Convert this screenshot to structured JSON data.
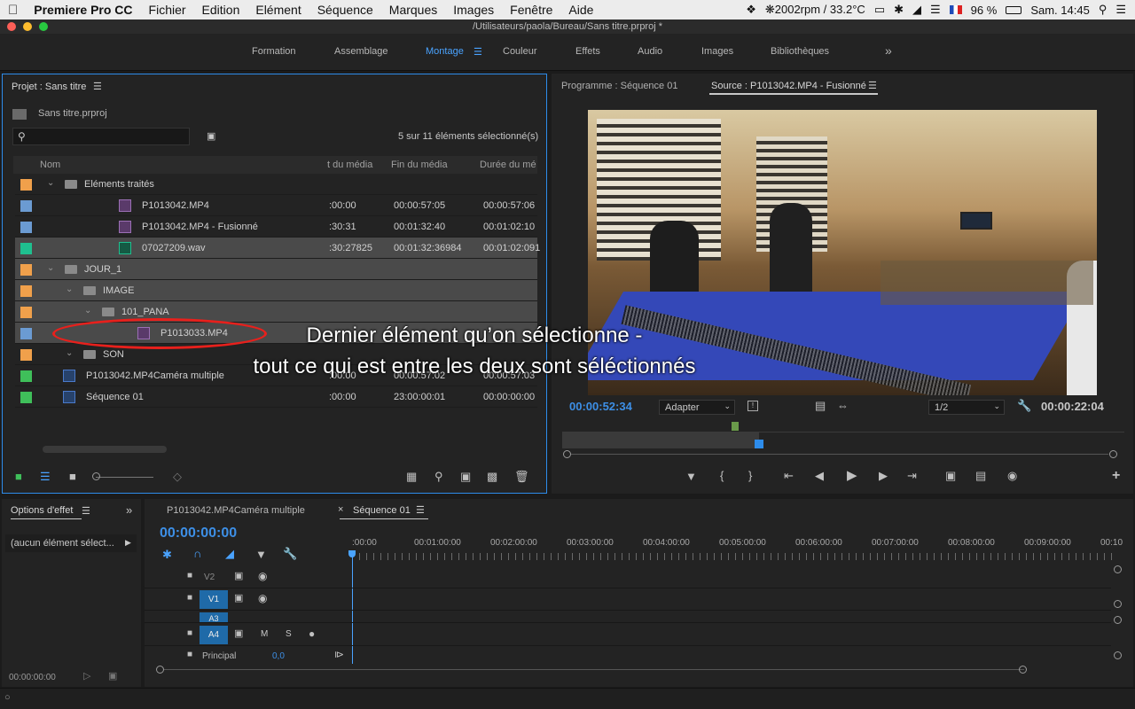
{
  "menubar": {
    "app": "Premiere Pro CC",
    "items": [
      "Fichier",
      "Edition",
      "Elément",
      "Séquence",
      "Marques",
      "Images",
      "Fenêtre",
      "Aide"
    ],
    "cpu": "2002rpm / 33.2°C",
    "battery": "96 %",
    "clock": "Sam. 14:45"
  },
  "window": {
    "title": "/Utilisateurs/paola/Bureau/Sans titre.prproj *"
  },
  "workspaces": [
    "Formation",
    "Assemblage",
    "Montage",
    "Couleur",
    "Effets",
    "Audio",
    "Images",
    "Bibliothèques"
  ],
  "project": {
    "title": "Projet : Sans titre",
    "file": "Sans titre.prproj",
    "search_placeholder": "",
    "selection": "5 sur 11 éléments sélectionné(s)",
    "headers": [
      "Nom",
      "t du média",
      "Fin du média",
      "Durée du mé"
    ],
    "rows": [
      {
        "name": "Eléments traités",
        "c1": "",
        "c2": "",
        "c3": "",
        "color": "#f0a04b",
        "type": "folder",
        "indent": 0,
        "sel": false
      },
      {
        "name": "P1013042.MP4",
        "c1": ":00:00",
        "c2": "00:00:57:05",
        "c3": "00:00:57:06",
        "color": "#6b9bd2",
        "type": "clip",
        "indent": 2,
        "sel": false
      },
      {
        "name": "P1013042.MP4 - Fusionné",
        "c1": ":30:31",
        "c2": "00:01:32:40",
        "c3": "00:01:02:10",
        "color": "#6b9bd2",
        "type": "clip",
        "indent": 2,
        "sel": false
      },
      {
        "name": "07027209.wav",
        "c1": ":30:27825",
        "c2": "00:01:32:36984",
        "c3": "00:01:02:091",
        "color": "#1fbf8f",
        "type": "audio",
        "indent": 2,
        "sel": true
      },
      {
        "name": "JOUR_1",
        "c1": "",
        "c2": "",
        "c3": "",
        "color": "#f0a04b",
        "type": "folder",
        "indent": 0,
        "sel": true
      },
      {
        "name": "IMAGE",
        "c1": "",
        "c2": "",
        "c3": "",
        "color": "#f0a04b",
        "type": "folder",
        "indent": 1,
        "sel": true
      },
      {
        "name": "101_PANA",
        "c1": "",
        "c2": "",
        "c3": "",
        "color": "#f0a04b",
        "type": "folder",
        "indent": 2,
        "sel": true
      },
      {
        "name": "P1013033.MP4",
        "c1": "",
        "c2": "",
        "c3": "",
        "color": "#6b9bd2",
        "type": "clip",
        "indent": 3,
        "sel": true
      },
      {
        "name": "SON",
        "c1": "",
        "c2": "",
        "c3": "",
        "color": "#f0a04b",
        "type": "folder",
        "indent": 1,
        "sel": false
      },
      {
        "name": "P1013042.MP4Caméra multiple",
        "c1": ":00:00",
        "c2": "00:00:57:02",
        "c3": "00:00:57:03",
        "color": "#3fbf5a",
        "type": "seq",
        "indent": 0,
        "sel": false
      },
      {
        "name": "Séquence 01",
        "c1": ":00:00",
        "c2": "23:00:00:01",
        "c3": "00:00:00:00",
        "color": "#3fbf5a",
        "type": "seq",
        "indent": 0,
        "sel": false
      }
    ]
  },
  "monitor": {
    "tab_program": "Programme : Séquence 01",
    "tab_source": "Source : P1013042.MP4 - Fusionné",
    "tc_left": "00:00:52:34",
    "fit": "Adapter",
    "res": "1/2",
    "tc_right": "00:00:22:04"
  },
  "effect": {
    "title": "Options d'effet",
    "none": "(aucun élément sélect...",
    "tc": "00:00:00:00"
  },
  "timeline": {
    "tab1": "P1013042.MP4Caméra multiple",
    "tab2": "Séquence 01",
    "tc": "00:00:00:00",
    "ruler": [
      ":00:00",
      "00:01:00:00",
      "00:02:00:00",
      "00:03:00:00",
      "00:04:00:00",
      "00:05:00:00",
      "00:06:00:00",
      "00:07:00:00",
      "00:08:00:00",
      "00:09:00:00",
      "00:10"
    ],
    "tracks": [
      "V2",
      "V1",
      "A3",
      "A4"
    ],
    "m": "M",
    "s": "S",
    "master": "Principal",
    "master_val": "0,0"
  },
  "overlay": {
    "line1": "Dernier élément qu’on sélectionne -",
    "line2": "tout ce qui est entre les deux sont séléctionnés"
  }
}
